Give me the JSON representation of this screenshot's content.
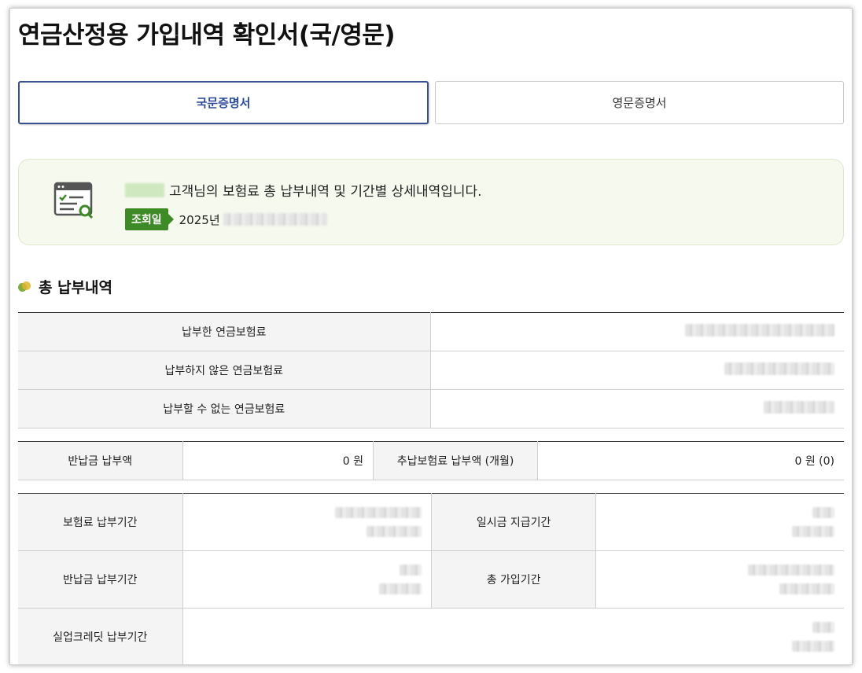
{
  "page": {
    "title": "연금산정용 가입내역 확인서(국/영문)"
  },
  "tabs": [
    {
      "label": "국문증명서",
      "active": true
    },
    {
      "label": "영문증명서",
      "active": false
    }
  ],
  "info": {
    "customer_suffix": "고객님의 보험료 총 납부내역 및 기간별 상세내역입니다.",
    "badge": "조회일",
    "date_prefix": "2025년"
  },
  "section": {
    "title": "총 납부내역"
  },
  "summary_rows": [
    {
      "label": "납부한 연금보험료"
    },
    {
      "label": "납부하지 않은 연금보험료"
    },
    {
      "label": "납부할 수 없는 연금보험료"
    }
  ],
  "refund_row": {
    "label1": "반납금 납부액",
    "value1": "0 원",
    "label2": "추납보험료 납부액 (개월)",
    "value2": "0 원 (0)"
  },
  "period_rows": [
    {
      "label1": "보험료 납부기간",
      "label2": "일시금 지급기간"
    },
    {
      "label1": "반납금 납부기간",
      "label2": "총 가입기간"
    },
    {
      "label1": "실업크레딧 납부기간"
    }
  ],
  "colors": {
    "accent_blue": "#3a4f8f",
    "badge_green": "#3d8a27",
    "info_bg": "#f5f9ee"
  }
}
